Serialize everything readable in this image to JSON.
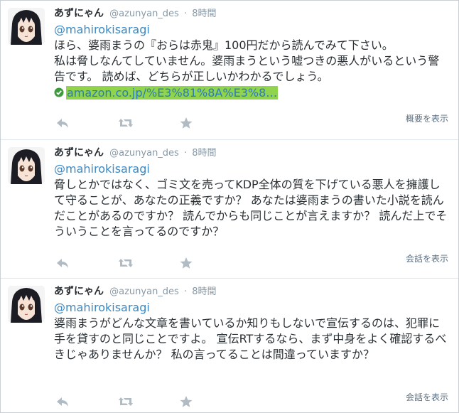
{
  "tweets": [
    {
      "name": "あずにゃん",
      "screen_name": "@azunyan_des",
      "separator": "·",
      "time": "8時間",
      "mention": "@mahirokisaragi",
      "text": "ほら、婆雨まうの『おらは赤鬼』100円だから読んでみて下さい。\n私は脅しなんてしていません。婆雨まうという嘘つきの悪人がいるという警告です。 読めば、どちらが正しいかわかるでしょう。",
      "link": "amazon.co.jp/%E3%81%8A%E3%8…",
      "expand_label": "概要を表示"
    },
    {
      "name": "あずにゃん",
      "screen_name": "@azunyan_des",
      "separator": "·",
      "time": "8時間",
      "mention": "@mahirokisaragi",
      "text": "脅しとかではなく、ゴミ文を売ってKDP全体の質を下げている悪人を擁護して守ることが、あなたの正義ですか？ あなたは婆雨まうの書いた小説を読んだことがあるのですか？ 読んでからも同じことが言えますか？ 読んだ上でそういうことを言ってるのですか？",
      "expand_label": "会話を表示"
    },
    {
      "name": "あずにゃん",
      "screen_name": "@azunyan_des",
      "separator": "·",
      "time": "8時間",
      "mention": "@mahirokisaragi",
      "text": "婆雨まうがどんな文章を書いているか知りもしないで宣伝するのは、犯罪に手を貸すのと同じことですよ。 宣伝RTするなら、まず中身をよく確認するべきじゃありませんか？ 私の言ってることは間違っていますか？",
      "expand_label": "会話を表示"
    }
  ],
  "icons": {
    "avatar": "anime-girl-avatar",
    "reply": "reply-icon",
    "retweet": "retweet-icon",
    "favorite": "star-icon",
    "link_badge": "verified-check-icon"
  },
  "colors": {
    "mention": "#3b88c3",
    "link_highlight": "#8fd44c",
    "meta": "#8899a6",
    "action_icon": "#b1bbc3"
  }
}
